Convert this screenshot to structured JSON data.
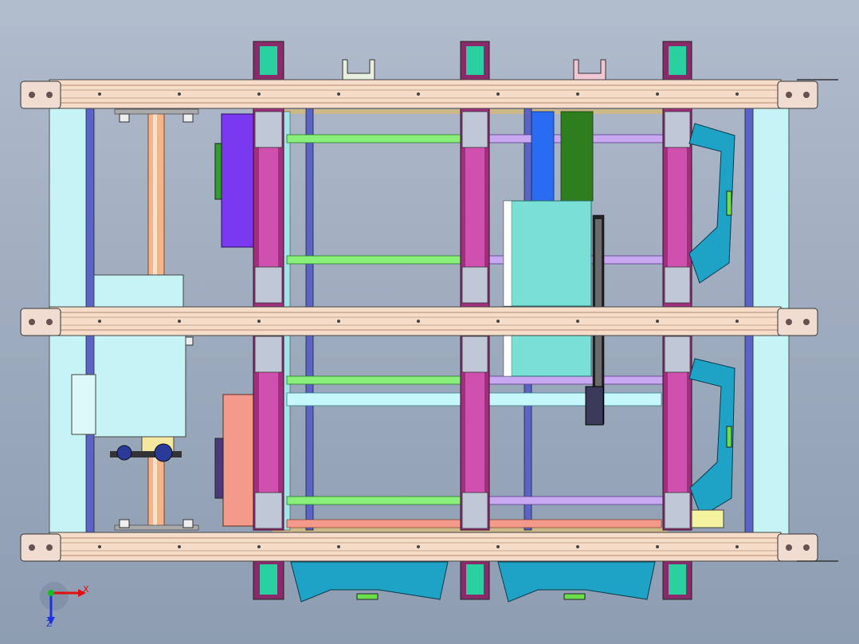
{
  "viewport": {
    "background_top": "#b1bccd",
    "background_bottom": "#8e9db2"
  },
  "triad": {
    "x_label": "X",
    "z_label": "Z",
    "x_color": "#e01010",
    "y_color": "#10c020",
    "z_color": "#2030e0"
  },
  "palette": {
    "rail_face": "#f6ddc9",
    "rail_stripe": "#c8a58b",
    "end_block": "#f1dcd2",
    "frame_blue": "#5a64c8",
    "frame_cyan": "#c6f4f6",
    "magenta_block": "#a0307e",
    "tan_frame": "#cdb88a",
    "green_shaft": "#88f07a",
    "lilac_shaft": "#c8a8f0",
    "orange_shaft": "#f6b48a",
    "teal_panel": "#7adfd4",
    "purple_motor": "#7a38f0",
    "salmon_motor": "#f39a8a",
    "blue_chute": "#1ea3c6",
    "green_bar": "#2e7d1e",
    "blue_bar": "#2a6cf0"
  }
}
